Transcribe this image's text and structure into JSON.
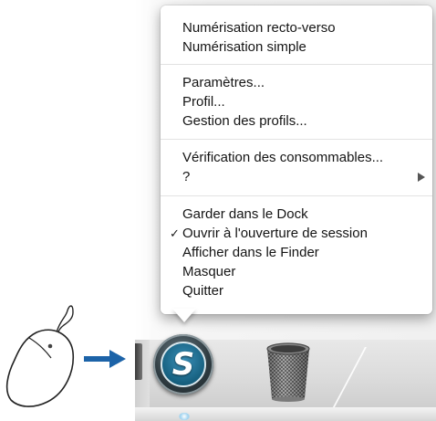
{
  "context_menu": {
    "groups": [
      {
        "items": [
          {
            "label": "Numérisation recto-verso"
          },
          {
            "label": "Numérisation simple"
          }
        ]
      },
      {
        "items": [
          {
            "label": "Paramètres..."
          },
          {
            "label": "Profil..."
          },
          {
            "label": "Gestion des profils..."
          }
        ]
      },
      {
        "items": [
          {
            "label": "Vérification des consommables..."
          },
          {
            "label": "?",
            "has_submenu": true
          }
        ]
      },
      {
        "items": [
          {
            "label": "Garder dans le Dock"
          },
          {
            "label": "Ouvrir à l'ouverture de session",
            "checked": true,
            "check_mark": "✓"
          },
          {
            "label": "Afficher dans le Finder"
          },
          {
            "label": "Masquer"
          },
          {
            "label": "Quitter"
          }
        ]
      }
    ]
  },
  "dock": {
    "app_icon": {
      "icon": "scansnap-s-icon",
      "letter": "S"
    },
    "trash_icon": "trash-icon"
  },
  "illustration": {
    "mouse_icon": "mouse-right-click-icon",
    "arrow_icon": "right-arrow-icon",
    "arrow_color": "#1c63a8"
  }
}
